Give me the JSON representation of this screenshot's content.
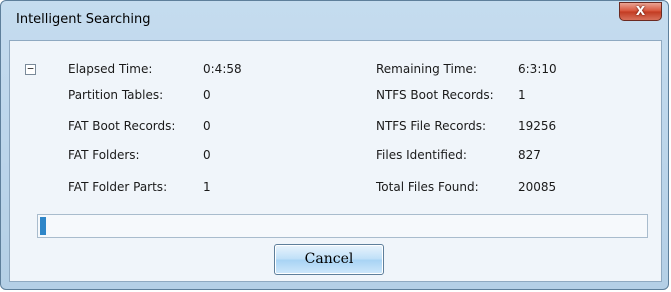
{
  "window": {
    "title": "Intelligent Searching",
    "close_label": "X"
  },
  "section": {
    "collapse_icon": "minus-box-icon",
    "collapse_glyph": "−"
  },
  "left": [
    {
      "label": "Elapsed Time:",
      "value": "0:4:58"
    },
    {
      "label": "Partition Tables:",
      "value": "0"
    },
    {
      "label": "FAT Boot Records:",
      "value": "0"
    },
    {
      "label": "FAT Folders:",
      "value": "0"
    },
    {
      "label": "FAT Folder Parts:",
      "value": "1"
    }
  ],
  "right": [
    {
      "label": "Remaining Time:",
      "value": "6:3:10"
    },
    {
      "label": "NTFS Boot Records:",
      "value": "1"
    },
    {
      "label": "NTFS File Records:",
      "value": "19256"
    },
    {
      "label": "Files Identified:",
      "value": "827"
    },
    {
      "label": "Total Files Found:",
      "value": "20085"
    }
  ],
  "progress": {
    "fraction": 0.01,
    "fill_color": "#2f86c8"
  },
  "cancel_label": "Cancel"
}
